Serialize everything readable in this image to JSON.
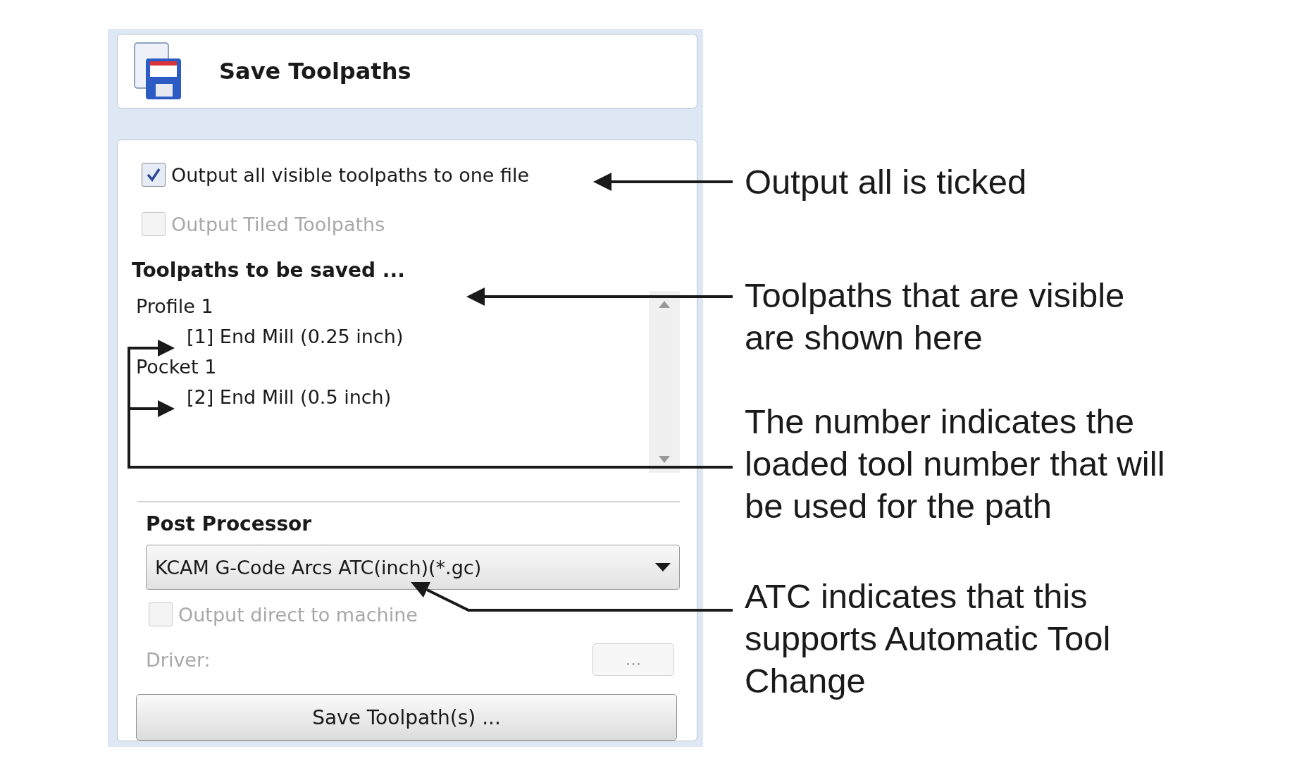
{
  "panel": {
    "title": "Save Toolpaths",
    "options": [
      {
        "label": "Output all visible toolpaths to one file",
        "checked": true,
        "disabled": false
      },
      {
        "label": "Output Tiled Toolpaths",
        "checked": false,
        "disabled": true
      }
    ],
    "toolpaths_heading": "Toolpaths to be saved ...",
    "toolpaths": [
      {
        "label": "Profile 1",
        "children": [
          {
            "label": "[1] End Mill (0.25 inch)"
          }
        ]
      },
      {
        "label": "Pocket 1",
        "children": [
          {
            "label": "[2] End Mill (0.5 inch)"
          }
        ]
      }
    ],
    "post_processor": {
      "heading": "Post Processor",
      "value": "KCAM G-Code Arcs ATC(inch)(*.gc)",
      "direct_option": {
        "label": "Output direct to machine",
        "checked": false,
        "disabled": true
      },
      "driver_label": "Driver:",
      "driver_button": "..."
    },
    "save_button": "Save Toolpath(s) ..."
  },
  "annotations": [
    {
      "lines": [
        "Output all is ticked"
      ]
    },
    {
      "lines": [
        "Toolpaths that are visible",
        "are shown here"
      ]
    },
    {
      "lines": [
        "The number indicates the",
        "loaded tool number that will",
        "be used for the path"
      ]
    },
    {
      "lines": [
        "ATC indicates that this",
        "supports Automatic Tool",
        "Change"
      ]
    }
  ]
}
